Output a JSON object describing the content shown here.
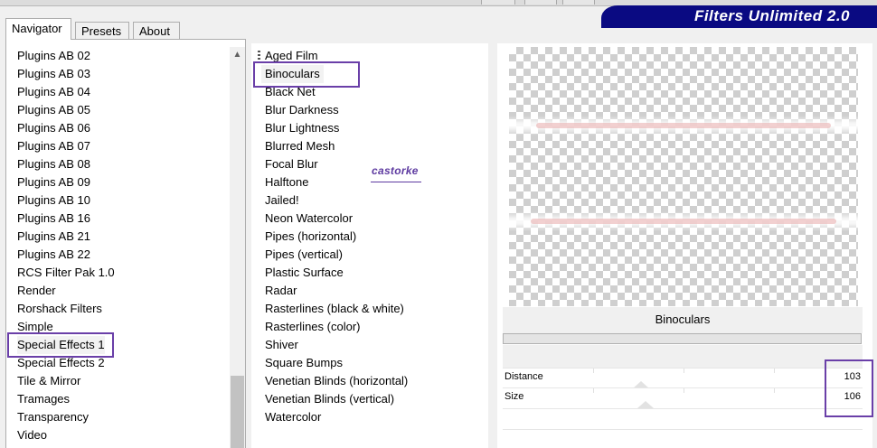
{
  "brand": {
    "title": "Filters Unlimited 2.0"
  },
  "tabs": [
    {
      "label": "Navigator",
      "active": true
    },
    {
      "label": "Presets",
      "active": false
    },
    {
      "label": "About",
      "active": false
    }
  ],
  "categories": [
    "Plugins AB 02",
    "Plugins AB 03",
    "Plugins AB 04",
    "Plugins AB 05",
    "Plugins AB 06",
    "Plugins AB 07",
    "Plugins AB 08",
    "Plugins AB 09",
    "Plugins AB 10",
    "Plugins AB 16",
    "Plugins AB 21",
    "Plugins AB 22",
    "RCS Filter Pak 1.0",
    "Render",
    "Rorshack Filters",
    "Simple",
    "Special Effects 1",
    "Special Effects 2",
    "Tile & Mirror",
    "Tramages",
    "Transparency",
    "Video"
  ],
  "selected_category": "Special Effects 1",
  "filters": [
    "Aged Film",
    "Binoculars",
    "Black Net",
    "Blur Darkness",
    "Blur Lightness",
    "Blurred Mesh",
    "Focal Blur",
    "Halftone",
    "Jailed!",
    "Neon Watercolor",
    "Pipes (horizontal)",
    "Pipes (vertical)",
    "Plastic Surface",
    "Radar",
    "Rasterlines (black & white)",
    "Rasterlines (color)",
    "Shiver",
    "Square Bumps",
    "Venetian Blinds (horizontal)",
    "Venetian Blinds (vertical)",
    "Watercolor"
  ],
  "selected_filter": "Binoculars",
  "watermark": "castorke",
  "filter_panel": {
    "title": "Binoculars",
    "params": [
      {
        "label": "Distance",
        "value": "103",
        "level": 103
      },
      {
        "label": "Size",
        "value": "106",
        "level": 106
      }
    ]
  },
  "colors": {
    "brand": "#0a0a82",
    "highlight": "#6a3fa8"
  }
}
